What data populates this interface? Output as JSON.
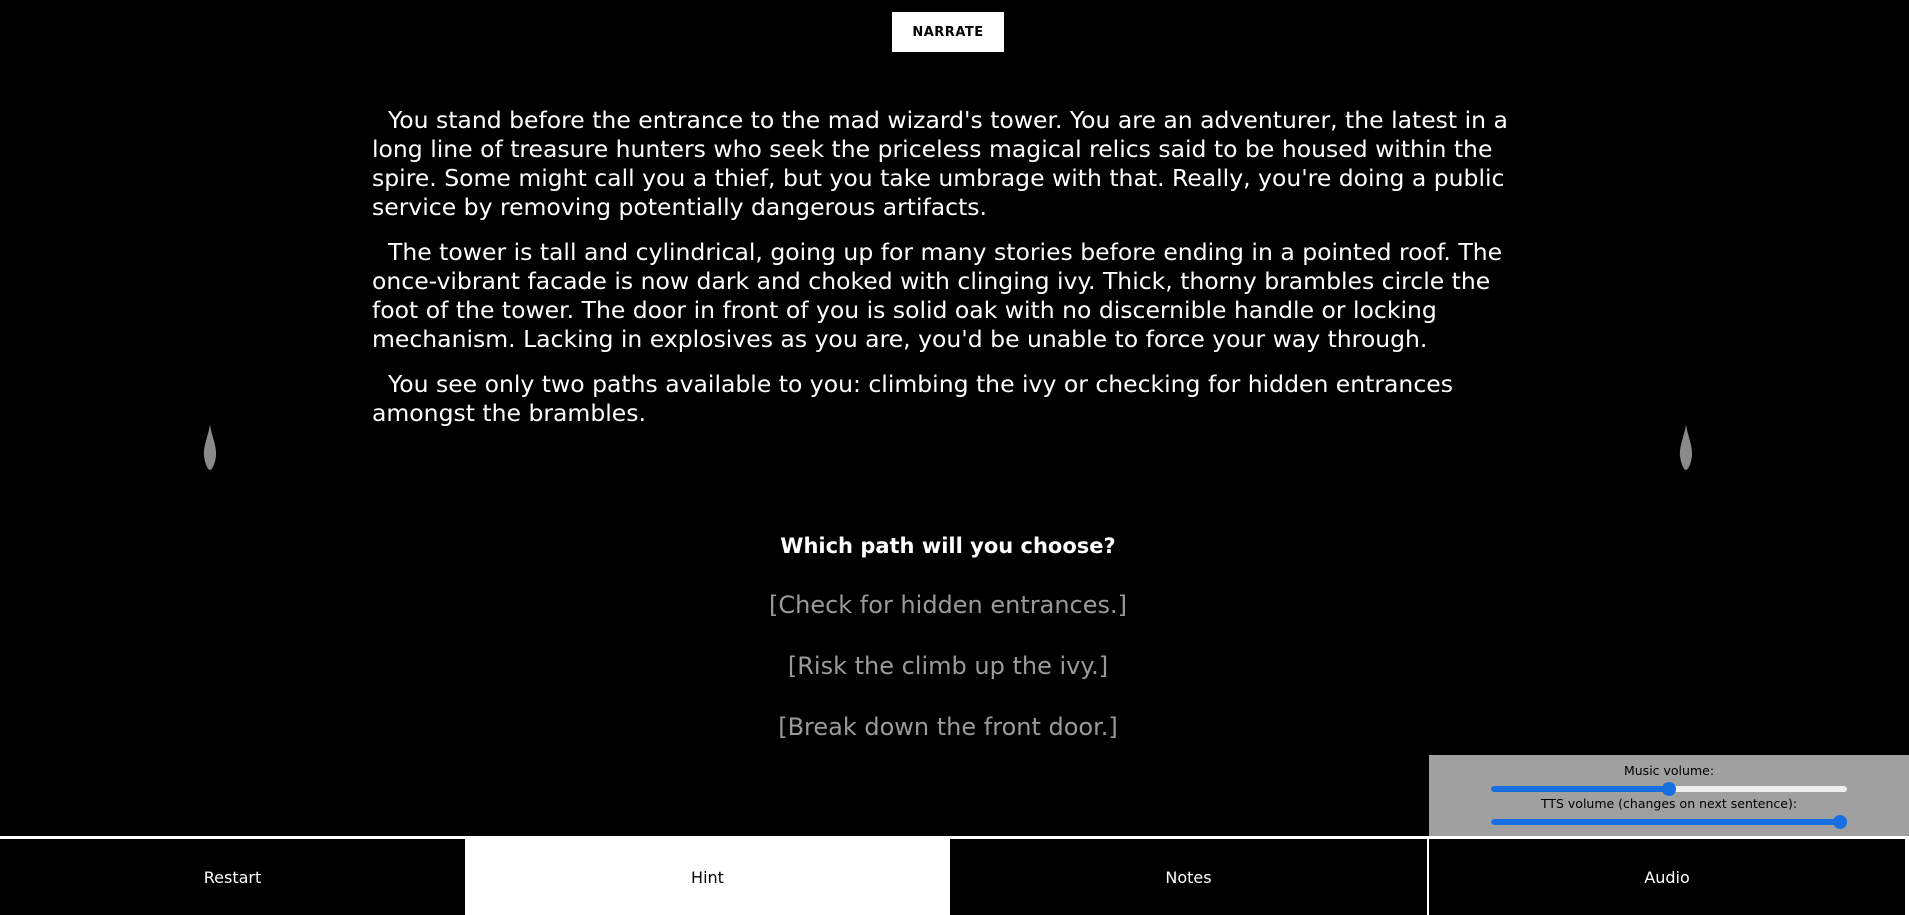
{
  "header": {
    "narrate_label": "NARRATE"
  },
  "story": {
    "paragraphs": [
      "You stand before the entrance to the mad wizard's tower. You are an adventurer, the latest in a long line of treasure hunters who seek the priceless magical relics said to be housed within the spire. Some might call you a thief, but you take umbrage with that. Really, you're doing a public service by removing potentially dangerous artifacts.",
      "The tower is tall and cylindrical, going up for many stories before ending in a pointed roof. The once-vibrant facade is now dark and choked with clinging ivy. Thick, thorny brambles circle the foot of the tower. The door in front of you is solid oak with no discernible handle or locking mechanism. Lacking in explosives as you are, you'd be unable to force your way through.",
      "You see only two paths available to you: climbing the ivy or checking for hidden entrances amongst the brambles."
    ]
  },
  "choices": {
    "prompt": "Which path will you choose?",
    "options": [
      "[Check for hidden entrances.]",
      "[Risk the climb up the ivy.]",
      "[Break down the front door.]"
    ]
  },
  "audio_panel": {
    "music_label": "Music volume:",
    "music_value": 0.5,
    "tts_label": "TTS volume (changes on next sentence):",
    "tts_value": 1.0
  },
  "bottom_bar": {
    "restart": "Restart",
    "hint": "Hint",
    "notes": "Notes",
    "audio": "Audio"
  },
  "icons": {
    "left_decoration": "flame-icon",
    "right_decoration": "flame-icon"
  },
  "colors": {
    "background": "#000000",
    "choice_text": "#9a9a9a",
    "slider_accent": "#1a6fe0",
    "panel_bg": "#a0a0a0"
  }
}
